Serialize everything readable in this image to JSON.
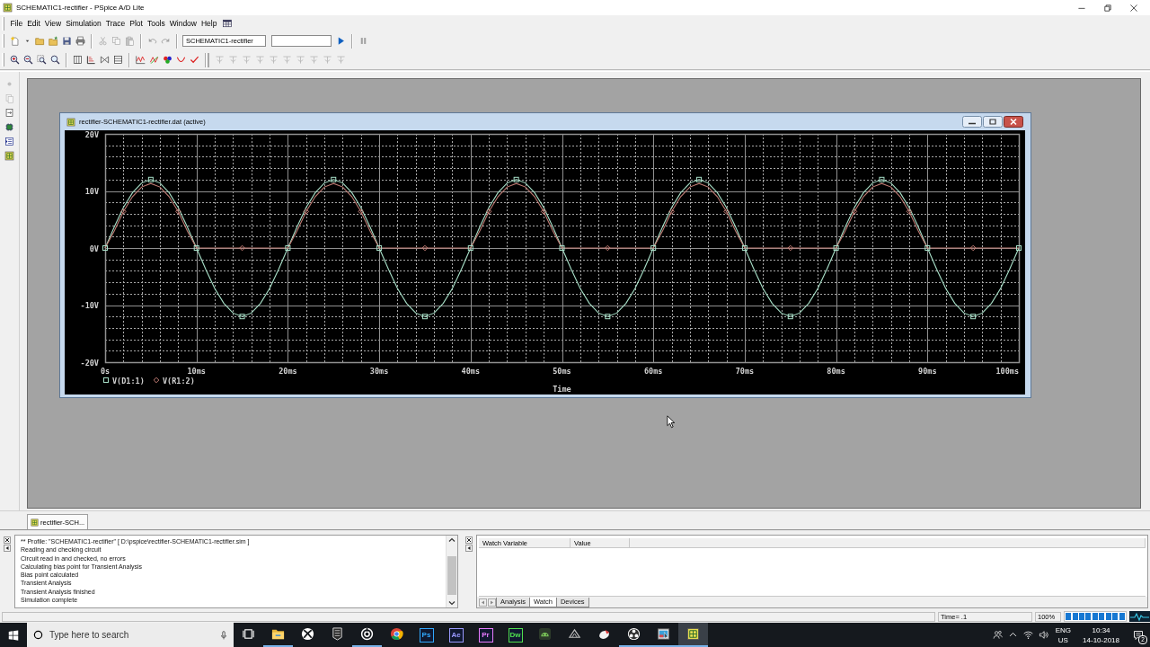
{
  "window": {
    "title": "SCHEMATIC1-rectifier - PSpice A/D Lite"
  },
  "menu": [
    {
      "label": "File"
    },
    {
      "label": "Edit"
    },
    {
      "label": "View"
    },
    {
      "label": "Simulation"
    },
    {
      "label": "Trace"
    },
    {
      "label": "Plot"
    },
    {
      "label": "Tools"
    },
    {
      "label": "Window"
    },
    {
      "label": "Help"
    }
  ],
  "toolbar_1": {
    "groups": [
      [
        {
          "kind": "new",
          "disabled": false
        },
        {
          "kind": "dropdown",
          "disabled": false
        },
        {
          "kind": "open",
          "disabled": false
        },
        {
          "kind": "opensim",
          "disabled": false
        },
        {
          "kind": "save",
          "disabled": false
        },
        {
          "kind": "print",
          "disabled": false
        }
      ],
      [
        {
          "kind": "cut",
          "disabled": true
        },
        {
          "kind": "copy",
          "disabled": true
        },
        {
          "kind": "paste",
          "disabled": true
        }
      ],
      [
        {
          "kind": "undo",
          "disabled": true
        },
        {
          "kind": "redo",
          "disabled": true
        }
      ]
    ],
    "profile_field": {
      "value": "SCHEMATIC1-rectifier"
    },
    "run_groups": [
      [
        {
          "kind": "run",
          "disabled": false
        }
      ],
      [
        {
          "kind": "pause",
          "disabled": true
        }
      ]
    ]
  },
  "toolbar_2": {
    "groups": [
      [
        {
          "kind": "zoomin",
          "disabled": false
        },
        {
          "kind": "zoomout",
          "disabled": false
        },
        {
          "kind": "zoomarea",
          "disabled": false
        },
        {
          "kind": "zoomfit",
          "disabled": false
        }
      ],
      [
        {
          "kind": "columns",
          "disabled": false
        },
        {
          "kind": "axis",
          "disabled": false
        },
        {
          "kind": "bowtie",
          "disabled": false
        },
        {
          "kind": "table",
          "disabled": false
        }
      ],
      [
        {
          "kind": "addtrace",
          "disabled": false
        },
        {
          "kind": "eval",
          "disabled": false
        },
        {
          "kind": "colors",
          "disabled": false
        },
        {
          "kind": "curve",
          "disabled": false
        },
        {
          "kind": "check",
          "disabled": false
        }
      ],
      [
        {
          "kind": "cursor",
          "disabled": true
        },
        {
          "kind": "cursor",
          "disabled": true
        },
        {
          "kind": "cursor",
          "disabled": true
        },
        {
          "kind": "cursor",
          "disabled": true
        },
        {
          "kind": "cursor",
          "disabled": true
        },
        {
          "kind": "cursor",
          "disabled": true
        },
        {
          "kind": "cursor",
          "disabled": true
        },
        {
          "kind": "cursor",
          "disabled": true
        },
        {
          "kind": "cursor",
          "disabled": true
        },
        {
          "kind": "cursor",
          "disabled": true
        }
      ]
    ]
  },
  "left_toolbar": {
    "buttons": [
      {
        "kind": "dot",
        "disabled": true
      },
      {
        "kind": "pages",
        "disabled": true
      },
      {
        "kind": "pagearrow",
        "disabled": false
      },
      {
        "kind": "chip",
        "disabled": false
      },
      {
        "kind": "listarrow",
        "disabled": false
      },
      {
        "kind": "board",
        "disabled": false
      }
    ]
  },
  "plot_window": {
    "title": "rectifier-SCHEMATIC1-rectifier.dat (active)",
    "chart_data": {
      "type": "line",
      "xlabel": "Time",
      "x": [
        0,
        1,
        2,
        3,
        4,
        5,
        6,
        7,
        8,
        9,
        10,
        11,
        12,
        13,
        14,
        15,
        16,
        17,
        18,
        19,
        20,
        21,
        22,
        23,
        24,
        25,
        26,
        27,
        28,
        29,
        30,
        31,
        32,
        33,
        34,
        35,
        36,
        37,
        38,
        39,
        40,
        41,
        42,
        43,
        44,
        45,
        46,
        47,
        48,
        49,
        50,
        51,
        52,
        53,
        54,
        55,
        56,
        57,
        58,
        59,
        60,
        61,
        62,
        63,
        64,
        65,
        66,
        67,
        68,
        69,
        70,
        71,
        72,
        73,
        74,
        75,
        76,
        77,
        78,
        79,
        80,
        81,
        82,
        83,
        84,
        85,
        86,
        87,
        88,
        89,
        90,
        91,
        92,
        93,
        94,
        95,
        96,
        97,
        98,
        99,
        100
      ],
      "xlim": [
        0,
        100
      ],
      "ylim": [
        -20,
        20
      ],
      "xticks": [
        {
          "value": 0,
          "label": "0s"
        },
        {
          "value": 10,
          "label": "10ms"
        },
        {
          "value": 20,
          "label": "20ms"
        },
        {
          "value": 30,
          "label": "30ms"
        },
        {
          "value": 40,
          "label": "40ms"
        },
        {
          "value": 50,
          "label": "50ms"
        },
        {
          "value": 60,
          "label": "60ms"
        },
        {
          "value": 70,
          "label": "70ms"
        },
        {
          "value": 80,
          "label": "80ms"
        },
        {
          "value": 90,
          "label": "90ms"
        },
        {
          "value": 100,
          "label": "100ms"
        }
      ],
      "yticks": [
        {
          "value": -20,
          "label": "-20V"
        },
        {
          "value": -10,
          "label": "-10V"
        },
        {
          "value": 0,
          "label": "0V"
        },
        {
          "value": 10,
          "label": "10V"
        },
        {
          "value": 20,
          "label": "20V"
        }
      ],
      "grid": true,
      "legend": "bottom-left",
      "series": [
        {
          "name": "V(D1:1)",
          "color": "#a8e0c8",
          "values": [
            0,
            3.7,
            7.1,
            9.7,
            11.4,
            12,
            11.4,
            9.7,
            7.1,
            3.7,
            0,
            -3.7,
            -7.1,
            -9.7,
            -11.4,
            -12,
            -11.4,
            -9.7,
            -7.1,
            -3.7,
            0,
            3.7,
            7.1,
            9.7,
            11.4,
            12,
            11.4,
            9.7,
            7.1,
            3.7,
            0,
            -3.7,
            -7.1,
            -9.7,
            -11.4,
            -12,
            -11.4,
            -9.7,
            -7.1,
            -3.7,
            0,
            3.7,
            7.1,
            9.7,
            11.4,
            12,
            11.4,
            9.7,
            7.1,
            3.7,
            0,
            -3.7,
            -7.1,
            -9.7,
            -11.4,
            -12,
            -11.4,
            -9.7,
            -7.1,
            -3.7,
            0,
            3.7,
            7.1,
            9.7,
            11.4,
            12,
            11.4,
            9.7,
            7.1,
            3.7,
            0,
            -3.7,
            -7.1,
            -9.7,
            -11.4,
            -12,
            -11.4,
            -9.7,
            -7.1,
            -3.7,
            0,
            3.7,
            7.1,
            9.7,
            11.4,
            12,
            11.4,
            9.7,
            7.1,
            3.7,
            0,
            -3.7,
            -7.1,
            -9.7,
            -11.4,
            -12,
            -11.4,
            -9.7,
            -7.1,
            -3.7,
            0
          ]
        },
        {
          "name": "V(R1:2)",
          "color": "#c07c74",
          "values": [
            0,
            3,
            6.4,
            9,
            10.7,
            11.3,
            10.7,
            9,
            6.4,
            3,
            0,
            0,
            0,
            0,
            0,
            0,
            0,
            0,
            0,
            0,
            0,
            3,
            6.4,
            9,
            10.7,
            11.3,
            10.7,
            9,
            6.4,
            3,
            0,
            0,
            0,
            0,
            0,
            0,
            0,
            0,
            0,
            0,
            0,
            3,
            6.4,
            9,
            10.7,
            11.3,
            10.7,
            9,
            6.4,
            3,
            0,
            0,
            0,
            0,
            0,
            0,
            0,
            0,
            0,
            0,
            0,
            3,
            6.4,
            9,
            10.7,
            11.3,
            10.7,
            9,
            6.4,
            3,
            0,
            0,
            0,
            0,
            0,
            0,
            0,
            0,
            0,
            0,
            0,
            3,
            6.4,
            9,
            10.7,
            11.3,
            10.7,
            9,
            6.4,
            3,
            0,
            0,
            0,
            0,
            0,
            0,
            0,
            0,
            0,
            0,
            0
          ]
        }
      ]
    }
  },
  "document_tabs": [
    {
      "label": "rectifier-SCH...",
      "selected": true
    }
  ],
  "output_log": {
    "lines": [
      "** Profile: \"SCHEMATIC1-rectifier\"  [ D:\\pspice\\rectifier-SCHEMATIC1-rectifier.sim ]",
      "Reading and checking circuit",
      "Circuit read in and checked, no errors",
      "Calculating bias point for Transient Analysis",
      "Bias point calculated",
      "Transient Analysis",
      "Transient Analysis finished",
      "Simulation complete"
    ]
  },
  "watch_panel": {
    "columns": [
      "Watch Variable",
      "Value"
    ],
    "tabs": [
      {
        "label": "Analysis",
        "selected": false
      },
      {
        "label": "Watch",
        "selected": true
      },
      {
        "label": "Devices",
        "selected": false
      }
    ]
  },
  "status_bar": {
    "time": "Time= .1",
    "percent": "100%",
    "progress": {
      "level": 1
    }
  },
  "taskbar": {
    "search": {
      "placeholder": "Type here to search"
    },
    "apps": [
      {
        "kind": "taskview",
        "running": false,
        "selected": false
      },
      {
        "kind": "folder",
        "running": true,
        "selected": false
      },
      {
        "kind": "xsphere",
        "running": false,
        "selected": false
      },
      {
        "kind": "shield",
        "running": false,
        "selected": false
      },
      {
        "kind": "ring",
        "running": true,
        "selected": false
      },
      {
        "kind": "browser",
        "running": false,
        "selected": false
      },
      {
        "kind": "tile",
        "label": "Ps",
        "color": "#31a8ff",
        "running": false,
        "selected": false
      },
      {
        "kind": "tile",
        "label": "Ae",
        "color": "#9999ff",
        "running": false,
        "selected": false
      },
      {
        "kind": "tile",
        "label": "Pr",
        "color": "#e77bff",
        "running": false,
        "selected": false
      },
      {
        "kind": "tile",
        "label": "Dw",
        "color": "#4fe04f",
        "running": false,
        "selected": false
      },
      {
        "kind": "robot",
        "running": false,
        "selected": false
      },
      {
        "kind": "wedge",
        "running": false,
        "selected": false
      },
      {
        "kind": "blob",
        "running": false,
        "selected": false
      },
      {
        "kind": "dots",
        "running": true,
        "selected": false
      },
      {
        "kind": "capture",
        "running": true,
        "selected": false
      },
      {
        "kind": "board",
        "running": true,
        "selected": true
      }
    ],
    "tray": {
      "language": "ENG",
      "region": "US",
      "time": "10:34",
      "date": "14-10-2018",
      "notifications": "2"
    }
  }
}
